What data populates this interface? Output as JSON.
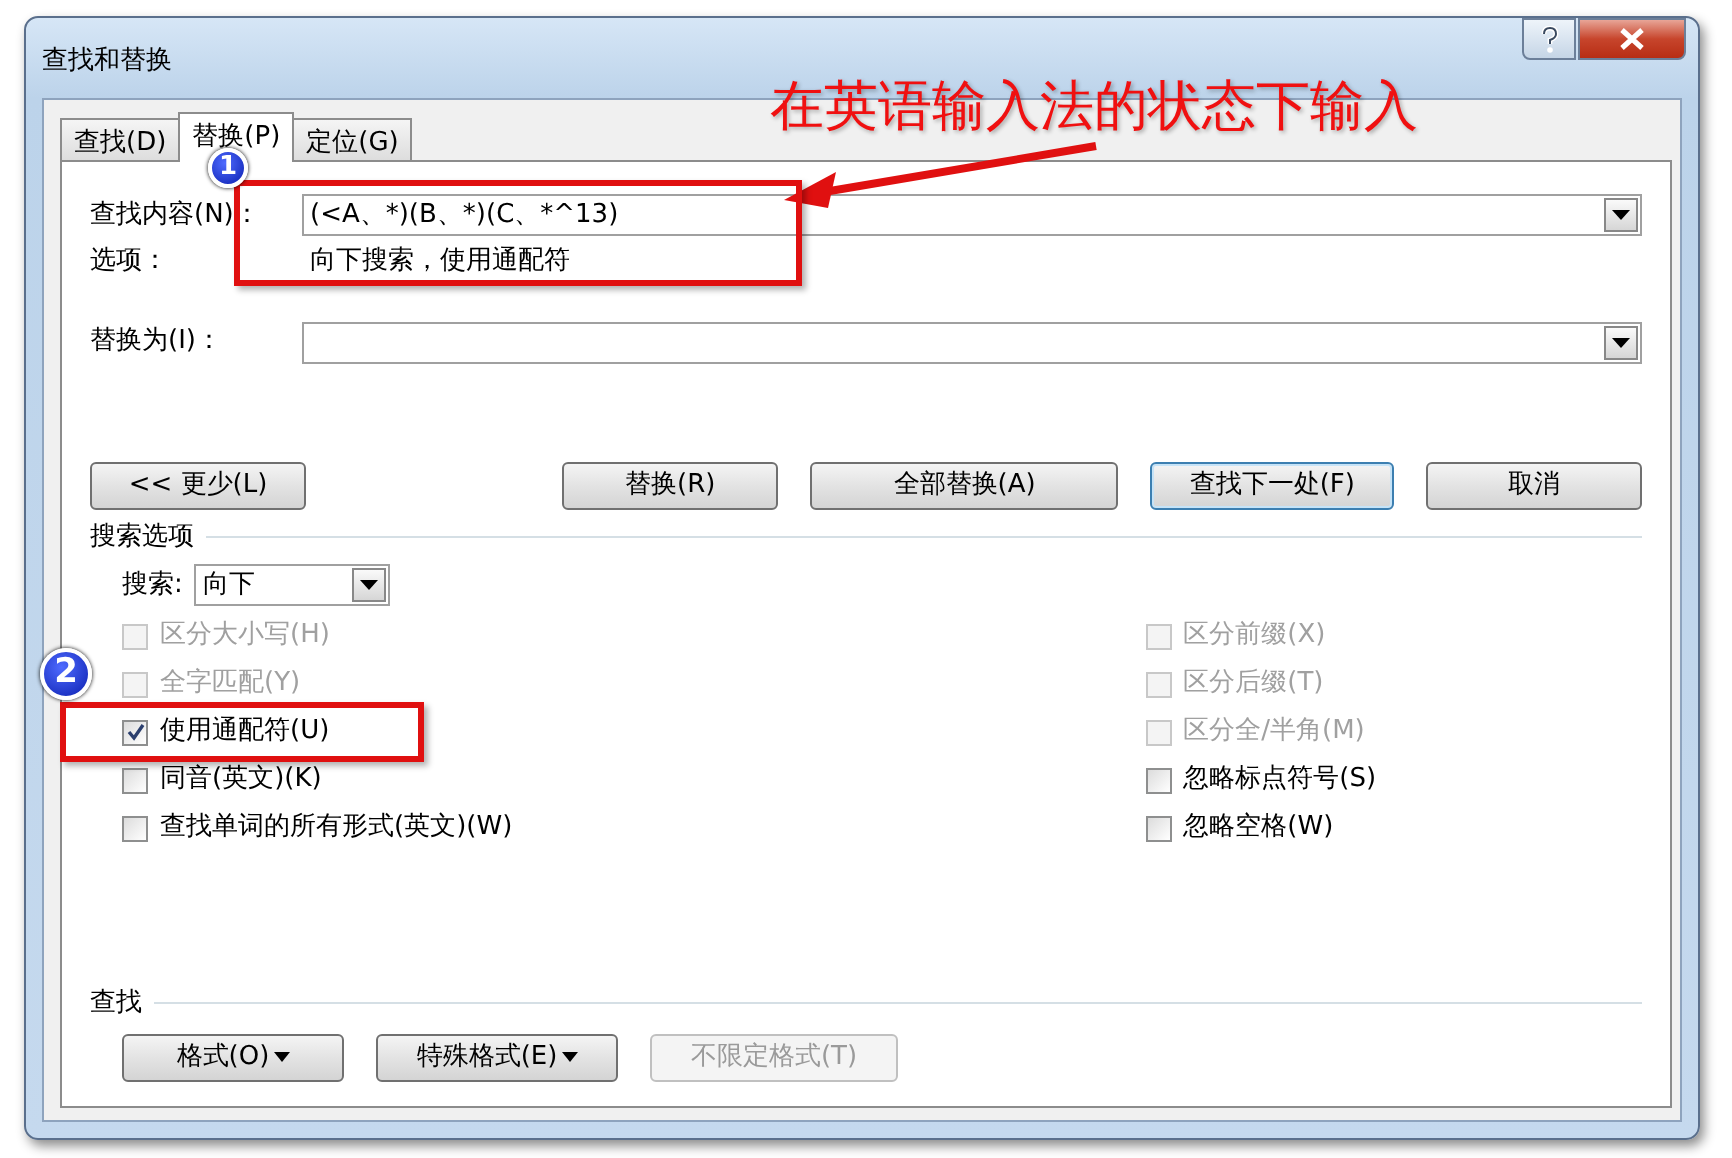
{
  "window": {
    "title": "查找和替换"
  },
  "tabs": [
    {
      "label": "查找(D)",
      "selected": false
    },
    {
      "label": "替换(P)",
      "selected": true
    },
    {
      "label": "定位(G)",
      "selected": false
    }
  ],
  "find": {
    "label": "查找内容(N)：",
    "value": "(<A、*)(B、*)(C、*^13)",
    "options_label": "选项：",
    "options_value": "向下搜索，使用通配符"
  },
  "replace": {
    "label": "替换为(I)："
  },
  "buttons": [
    {
      "label": "<< 更少(L)",
      "default": false
    },
    {
      "label": "替换(R)",
      "default": false
    },
    {
      "label": "全部替换(A)",
      "default": false
    },
    {
      "label": "查找下一处(F)",
      "default": true
    },
    {
      "label": "取消",
      "default": false
    }
  ],
  "search_options": {
    "heading": "搜索选项",
    "direction_label": "搜索:",
    "direction_value": "向下",
    "left": [
      {
        "label": "区分大小写(H)",
        "checked": false,
        "disabled": true
      },
      {
        "label": "全字匹配(Y)",
        "checked": false,
        "disabled": true
      },
      {
        "label": "使用通配符(U)",
        "checked": true,
        "disabled": false
      },
      {
        "label": "同音(英文)(K)",
        "checked": false,
        "disabled": false
      },
      {
        "label": "查找单词的所有形式(英文)(W)",
        "checked": false,
        "disabled": false
      }
    ],
    "right": [
      {
        "label": "区分前缀(X)",
        "checked": false,
        "disabled": true
      },
      {
        "label": "区分后缀(T)",
        "checked": false,
        "disabled": true
      },
      {
        "label": "区分全/半角(M)",
        "checked": false,
        "disabled": true
      },
      {
        "label": "忽略标点符号(S)",
        "checked": false,
        "disabled": false
      },
      {
        "label": "忽略空格(W)",
        "checked": false,
        "disabled": false
      }
    ]
  },
  "find_format": {
    "heading": "查找",
    "buttons": [
      {
        "label": "格式(O)",
        "dropdown": true,
        "disabled": false
      },
      {
        "label": "特殊格式(E)",
        "dropdown": true,
        "disabled": false
      },
      {
        "label": "不限定格式(T)",
        "dropdown": false,
        "disabled": true
      }
    ]
  },
  "annotations": {
    "callout": "在英语输入法的状态下输入",
    "markers": [
      "1",
      "2"
    ]
  }
}
